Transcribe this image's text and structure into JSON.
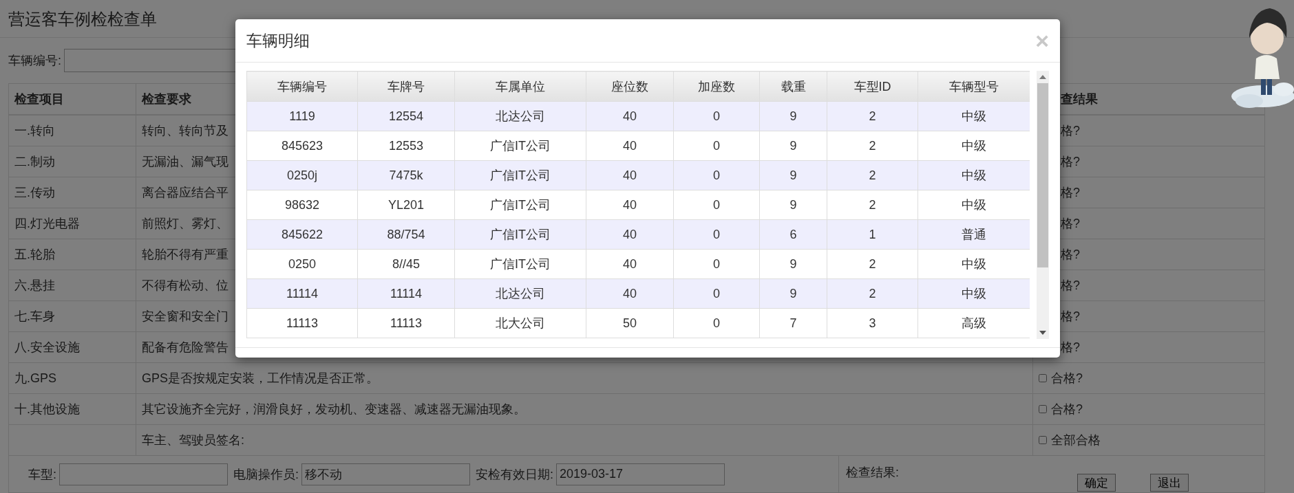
{
  "page": {
    "title": "营运客车例检检查单",
    "vehicle_no_label": "车辆编号:"
  },
  "inspection_table": {
    "columns": [
      "检查项目",
      "检查要求",
      "查结果"
    ],
    "rows": [
      {
        "item": "一.转向",
        "requirement": "转向、转向节及",
        "result": {
          "label": "格?"
        }
      },
      {
        "item": "二.制动",
        "requirement": "无漏油、漏气现",
        "result": {
          "label": "格?"
        }
      },
      {
        "item": "三.传动",
        "requirement": "离合器应结合平",
        "result": {
          "label": "格?"
        }
      },
      {
        "item": "四.灯光电器",
        "requirement": "前照灯、雾灯、",
        "result": {
          "label": "格?"
        }
      },
      {
        "item": "五.轮胎",
        "requirement": "轮胎不得有严重",
        "result": {
          "label": "格?"
        }
      },
      {
        "item": "六.悬挂",
        "requirement": "不得有松动、位",
        "result": {
          "label": "格?"
        }
      },
      {
        "item": "七.车身",
        "requirement": "安全窗和安全门",
        "result": {
          "label": "格?"
        }
      },
      {
        "item": "八.安全设施",
        "requirement": "配备有危险警告",
        "result": {
          "label": "格?"
        }
      },
      {
        "item": "九.GPS",
        "requirement": "GPS是否按规定安装，工作情况是否正常。",
        "result": {
          "label": "合格?",
          "checked": false
        }
      },
      {
        "item": "十.其他设施",
        "requirement": "其它设施齐全完好，润滑良好，发动机、变速器、减速器无漏油现象。",
        "result": {
          "label": "合格?",
          "checked": false
        }
      },
      {
        "item": "",
        "requirement": "车主、驾驶员签名:",
        "result": {
          "label": "全部合格",
          "checked": false
        }
      }
    ]
  },
  "footer_fields": [
    {
      "label": "车型:"
    },
    {
      "label": "电脑操作员:",
      "value": "移不动"
    },
    {
      "label": "安检有效日期:",
      "value": "2019-03-17"
    }
  ],
  "result_label": "检查结果:",
  "buttons": [
    "确定",
    "退出"
  ],
  "modal": {
    "title": "车辆明细",
    "close": "×",
    "columns": [
      "车辆编号",
      "车牌号",
      "车属单位",
      "座位数",
      "加座数",
      "载重",
      "车型ID",
      "车辆型号"
    ],
    "rows": [
      [
        "1119",
        "12554",
        "北达公司",
        "40",
        "0",
        "9",
        "2",
        "中级"
      ],
      [
        "845623",
        "12553",
        "广信IT公司",
        "40",
        "0",
        "9",
        "2",
        "中级"
      ],
      [
        "0250j",
        "7475k",
        "广信IT公司",
        "40",
        "0",
        "9",
        "2",
        "中级"
      ],
      [
        "98632",
        "YL201",
        "广信IT公司",
        "40",
        "0",
        "9",
        "2",
        "中级"
      ],
      [
        "845622",
        "88/754",
        "广信IT公司",
        "40",
        "0",
        "6",
        "1",
        "普通"
      ],
      [
        "0250",
        "8//45",
        "广信IT公司",
        "40",
        "0",
        "9",
        "2",
        "中级"
      ],
      [
        "11114",
        "11114",
        "北达公司",
        "40",
        "0",
        "9",
        "2",
        "中级"
      ],
      [
        "11113",
        "11113",
        "北大公司",
        "50",
        "0",
        "7",
        "3",
        "高级"
      ]
    ]
  }
}
